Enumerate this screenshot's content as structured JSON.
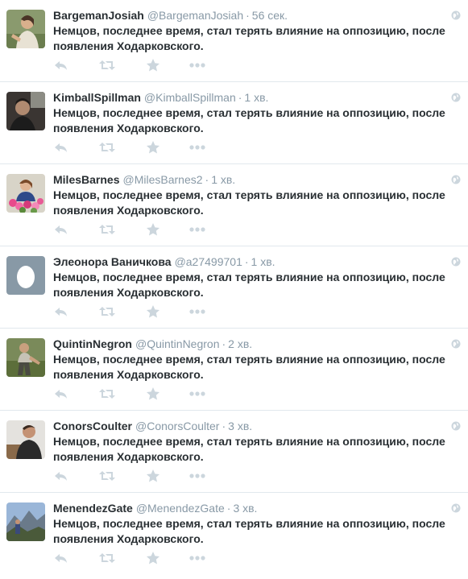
{
  "tweets": [
    {
      "name": "BargemanJosiah",
      "handle": "@BargemanJosiah",
      "time": "56 сек.",
      "text": "Немцов, последнее время, стал терять влияние на оппозицию, после появления Ходарковского.",
      "avatar": "photo-woman-outdoors"
    },
    {
      "name": "KimballSpillman",
      "handle": "@KimballSpillman",
      "time": "1 хв.",
      "text": "Немцов, последнее время, стал терять влияние на оппозицию, после появления Ходарковского.",
      "avatar": "photo-man-dark"
    },
    {
      "name": "MilesBarnes",
      "handle": "@MilesBarnes2",
      "time": "1 хв.",
      "text": "Немцов, последнее время, стал терять влияние на оппозицию, после появления Ходарковского.",
      "avatar": "photo-woman-flowers"
    },
    {
      "name": "Элеонора Ваничкова",
      "handle": "@a27499701",
      "time": "1 хв.",
      "text": "Немцов, последнее время, стал терять влияние на оппозицию, после появления Ходарковского.",
      "avatar": "default-egg"
    },
    {
      "name": "QuintinNegron",
      "handle": "@QuintinNegron",
      "time": "2 хв.",
      "text": "Немцов, последнее время, стал терять влияние на оппозицию, после появления Ходарковского.",
      "avatar": "photo-man-grass"
    },
    {
      "name": "ConorsCoulter",
      "handle": "@ConorsCoulter",
      "time": "3 хв.",
      "text": "Немцов, последнее время, стал терять влияние на оппозицию, после появления Ходарковского.",
      "avatar": "photo-man-sitting"
    },
    {
      "name": "MenendezGate",
      "handle": "@MenendezGate",
      "time": "3 хв.",
      "text": "Немцов, последнее время, стал терять влияние на оппозицию, после появления Ходарковского.",
      "avatar": "photo-person-mountains"
    }
  ],
  "dot": "·",
  "icons": {
    "reply": "reply-icon",
    "retweet": "retweet-icon",
    "favorite": "star-icon",
    "more": "more-icon",
    "globe": "globe-icon"
  },
  "colors": {
    "action_icon": "#ccd6dd",
    "name": "#292f33",
    "muted": "#8899a6",
    "divider": "#e1e8ed"
  }
}
